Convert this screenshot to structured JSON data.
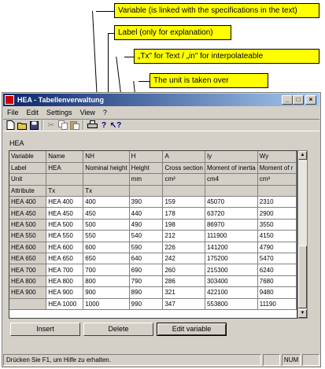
{
  "annotations": [
    "Variable (is linked with the specifications in the text)",
    "Label (only for explanation)",
    "„Tx\" for Text / „in\" for interpolateable",
    "The unit is taken over"
  ],
  "window": {
    "title": "HEA - Tabellenverwaltung",
    "controls": {
      "minimize": "_",
      "maximize": "□",
      "close": "×"
    }
  },
  "menu": [
    "File",
    "Edit",
    "Settings",
    "View",
    "?"
  ],
  "toolbar_icons": [
    "new-icon",
    "open-icon",
    "save-icon",
    "cut-icon",
    "copy-icon",
    "paste-icon",
    "print-icon",
    "help-icon",
    "context-help-icon"
  ],
  "document_title": "HEA",
  "grid": {
    "header_rows": [
      [
        "Variable",
        "Name",
        "NH",
        "H",
        "A",
        "Iy",
        "Wy"
      ],
      [
        "Label",
        "HEA",
        "Nominal height",
        "Height",
        "Cross section",
        "Moment of inertia",
        "Moment of r"
      ],
      [
        "Unit",
        "",
        "",
        "mm",
        "cm²",
        "cm4",
        "cm³"
      ],
      [
        "Attribute",
        "Tx",
        "Tx",
        "",
        "",
        "",
        ""
      ]
    ],
    "rows": [
      [
        "HEA 400",
        "HEA 400",
        "400",
        "390",
        "159",
        "45070",
        "2310"
      ],
      [
        "HEA 450",
        "HEA 450",
        "450",
        "440",
        "178",
        "63720",
        "2900"
      ],
      [
        "HEA 500",
        "HEA 500",
        "500",
        "490",
        "198",
        "86970",
        "3550"
      ],
      [
        "HEA 550",
        "HEA 550",
        "550",
        "540",
        "212",
        "111900",
        "4150"
      ],
      [
        "HEA 600",
        "HEA 600",
        "600",
        "590",
        "226",
        "141200",
        "4790"
      ],
      [
        "HEA 650",
        "HEA 650",
        "650",
        "640",
        "242",
        "175200",
        "5470"
      ],
      [
        "HEA 700",
        "HEA 700",
        "700",
        "690",
        "260",
        "215300",
        "6240"
      ],
      [
        "HEA 800",
        "HEA 800",
        "800",
        "790",
        "286",
        "303400",
        "7680"
      ],
      [
        "HEA 900",
        "HEA 900",
        "900",
        "890",
        "321",
        "422100",
        "9480"
      ],
      [
        "",
        "HEA 1000",
        "1000",
        "990",
        "347",
        "553800",
        "11190"
      ]
    ]
  },
  "buttons": {
    "insert": "Insert",
    "delete": "Delete",
    "edit_variable": "Edit variable"
  },
  "status": {
    "text": "Drücken Sie F1, um Hilfe zu erhalten.",
    "num": "NUM"
  }
}
